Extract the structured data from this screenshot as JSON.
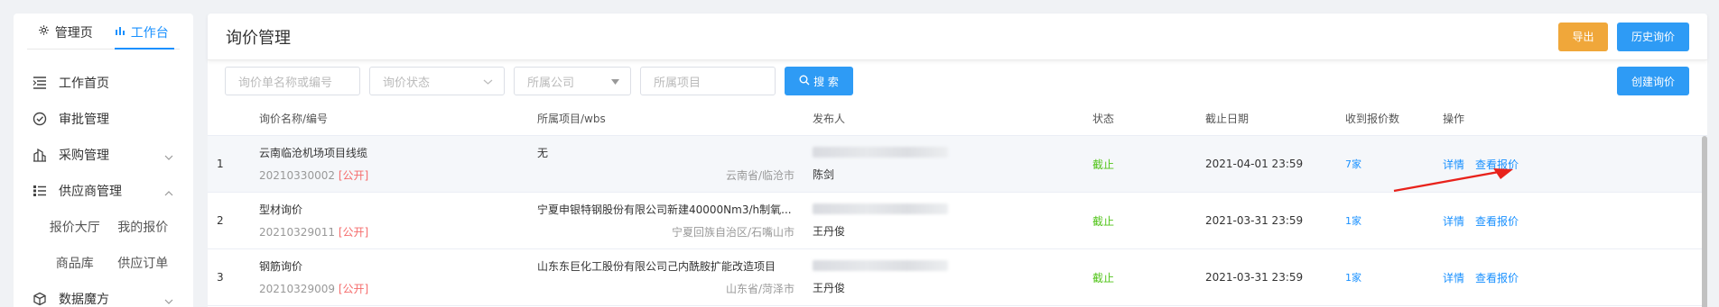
{
  "sidebar": {
    "tabs": [
      {
        "label": "管理页",
        "icon": "gear-icon"
      },
      {
        "label": "工作台",
        "icon": "bar-chart-icon"
      }
    ],
    "items": [
      {
        "label": "工作首页",
        "icon": "list-indent-icon"
      },
      {
        "label": "审批管理",
        "icon": "check-circle-icon"
      },
      {
        "label": "采购管理",
        "icon": "building-icon",
        "chevron": "down"
      },
      {
        "label": "供应商管理",
        "icon": "grid-list-icon",
        "chevron": "up"
      }
    ],
    "sub_items": [
      "报价大厅",
      "我的报价",
      "商品库",
      "供应订单"
    ],
    "after": [
      {
        "label": "数据魔方",
        "icon": "cube-icon",
        "chevron": "down"
      }
    ]
  },
  "header": {
    "title": "询价管理",
    "export_label": "导出",
    "history_label": "历史询价"
  },
  "filters": {
    "name_placeholder": "询价单名称或编号",
    "status_placeholder": "询价状态",
    "company_placeholder": "所属公司",
    "project_placeholder": "所属项目",
    "search_label": "搜 索",
    "create_label": "创建询价"
  },
  "table": {
    "headers": {
      "name": "询价名称/编号",
      "project": "所属项目/wbs",
      "publisher": "发布人",
      "status": "状态",
      "deadline": "截止日期",
      "count": "收到报价数",
      "ops": "操作"
    },
    "rows": [
      {
        "idx": "1",
        "name": "云南临沧机场项目线缆",
        "code": "20210330002",
        "tag": "[公开]",
        "project": "无",
        "region": "云南省/临沧市",
        "publisher": "陈剑",
        "status": "截止",
        "deadline": "2021-04-01 23:59",
        "count": "7家",
        "detail": "详情",
        "view": "查看报价"
      },
      {
        "idx": "2",
        "name": "型材询价",
        "code": "20210329011",
        "tag": "[公开]",
        "project": "宁夏申银特钢股份有限公司新建40000Nm3/h制氧...",
        "region": "宁夏回族自治区/石嘴山市",
        "publisher": "王丹俊",
        "status": "截止",
        "deadline": "2021-03-31 23:59",
        "count": "1家",
        "detail": "详情",
        "view": "查看报价"
      },
      {
        "idx": "3",
        "name": "钢筋询价",
        "code": "20210329009",
        "tag": "[公开]",
        "project": "山东东巨化工股份有限公司己内酰胺扩能改造项目",
        "region": "山东省/菏泽市",
        "publisher": "王丹俊",
        "status": "截止",
        "deadline": "2021-03-31 23:59",
        "count": "1家",
        "detail": "详情",
        "view": "查看报价"
      }
    ]
  },
  "colors": {
    "accent": "#1890ff",
    "orange": "#f0a73a",
    "status_green": "#52c41a",
    "tag_red": "#f56c6c",
    "arrow_red": "#e8221b"
  }
}
